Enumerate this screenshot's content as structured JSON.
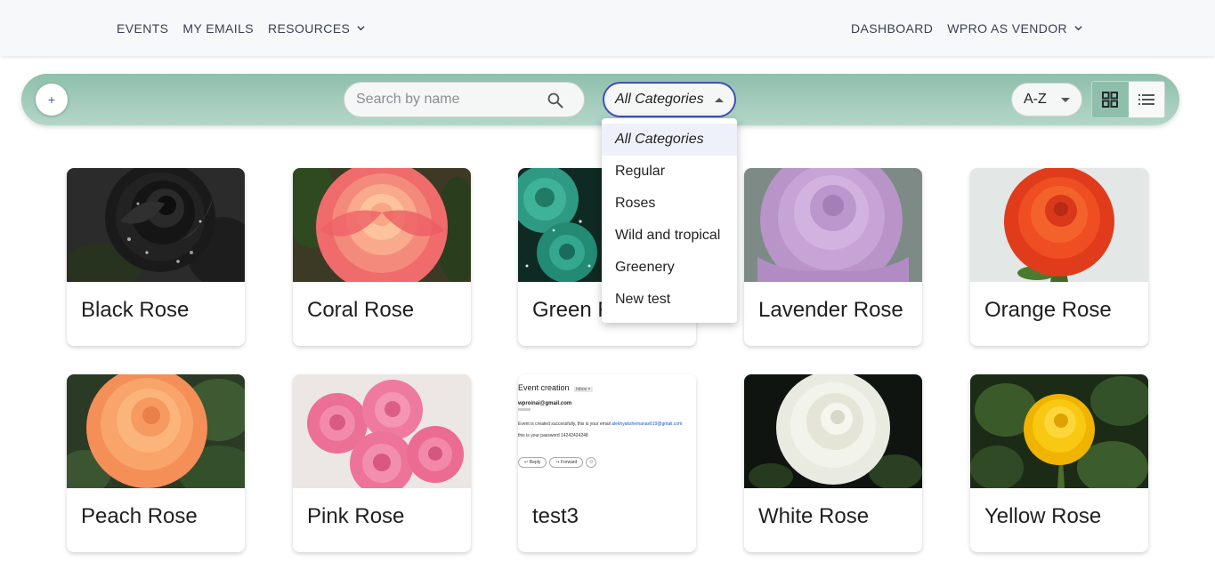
{
  "nav": {
    "left": [
      {
        "label": "EVENTS"
      },
      {
        "label": "MY EMAILS"
      },
      {
        "label": "RESOURCES",
        "dropdown": true
      }
    ],
    "right": [
      {
        "label": "DASHBOARD"
      },
      {
        "label": "WPRO AS VENDOR",
        "dropdown": true
      }
    ]
  },
  "toolbar": {
    "add_label": "+",
    "search_placeholder": "Search by name",
    "category_value": "All Categories",
    "sort_value": "A-Z"
  },
  "category_options": [
    "All Categories",
    "Regular",
    "Roses",
    "Wild and tropical",
    "Greenery",
    "New test"
  ],
  "cards": [
    {
      "name": "Black Rose"
    },
    {
      "name": "Coral Rose"
    },
    {
      "name": "Green Rose"
    },
    {
      "name": "Lavender Rose"
    },
    {
      "name": "Orange Rose"
    },
    {
      "name": "Peach Rose"
    },
    {
      "name": "Pink Rose"
    },
    {
      "name": "test3"
    },
    {
      "name": "White Rose"
    },
    {
      "name": "Yellow Rose"
    }
  ],
  "test3_preview": {
    "subject": "Event creation",
    "tag": "Inbox ×",
    "from": "wproinai@gmail.com",
    "line1": "Event is created successfully, this is your email",
    "email": "alekhyakshemanas619@gmail.com",
    "line2": "this is your password 14242424248",
    "reply": "Reply",
    "forward": "Forward"
  },
  "colors": {
    "toolbar_accent": "#8fbfac",
    "select_border": "#3f51b5"
  }
}
